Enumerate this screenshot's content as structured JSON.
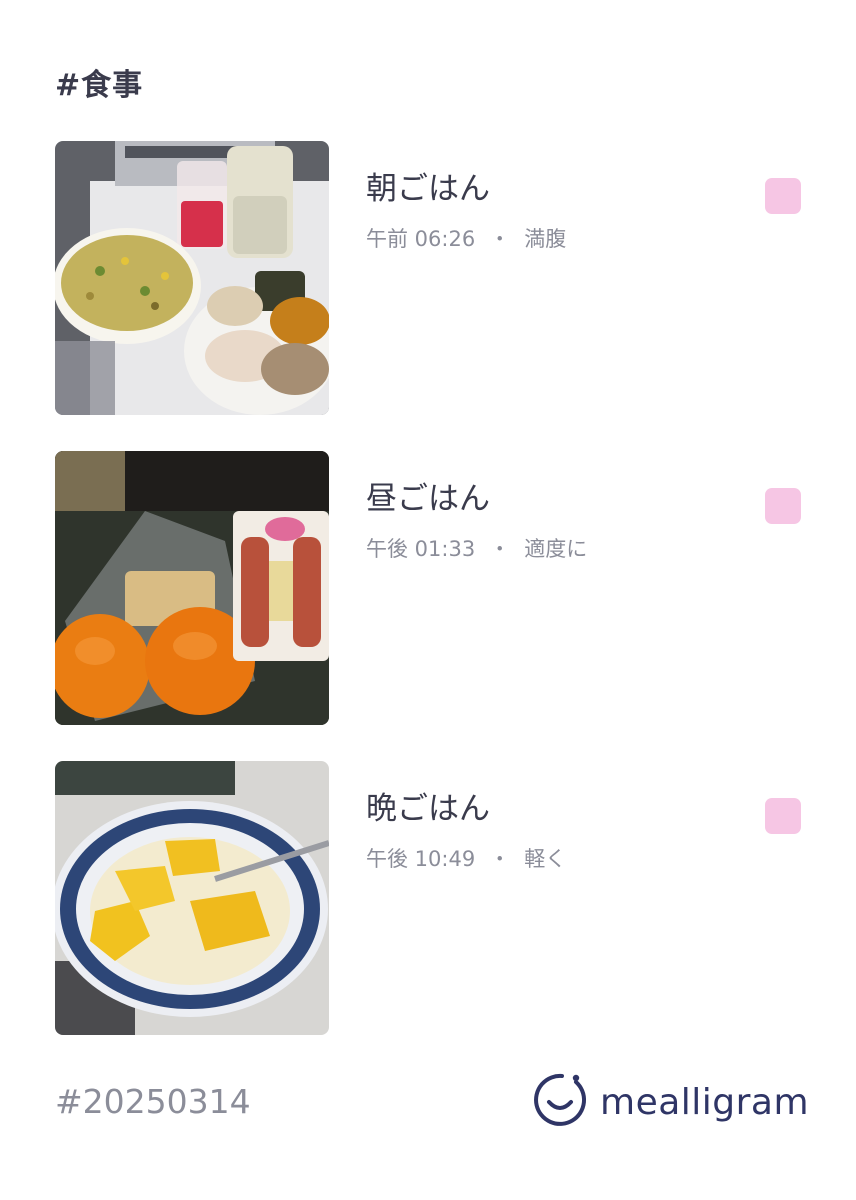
{
  "header": {
    "title": "#食事"
  },
  "meals": [
    {
      "name": "朝ごはん",
      "time": "午前 06:26",
      "separator": "・",
      "fullness": "満腹",
      "mood_color": "#f6c6e4",
      "photo_icon": "breakfast-photo"
    },
    {
      "name": "昼ごはん",
      "time": "午後 01:33",
      "separator": "・",
      "fullness": "適度に",
      "mood_color": "#f6c6e4",
      "photo_icon": "lunch-photo"
    },
    {
      "name": "晩ごはん",
      "time": "午後 10:49",
      "separator": "・",
      "fullness": "軽く",
      "mood_color": "#f6c6e4",
      "photo_icon": "dinner-photo"
    }
  ],
  "footer": {
    "date_tag": "#20250314",
    "brand": "mealligram",
    "brand_color": "#2f3566"
  }
}
